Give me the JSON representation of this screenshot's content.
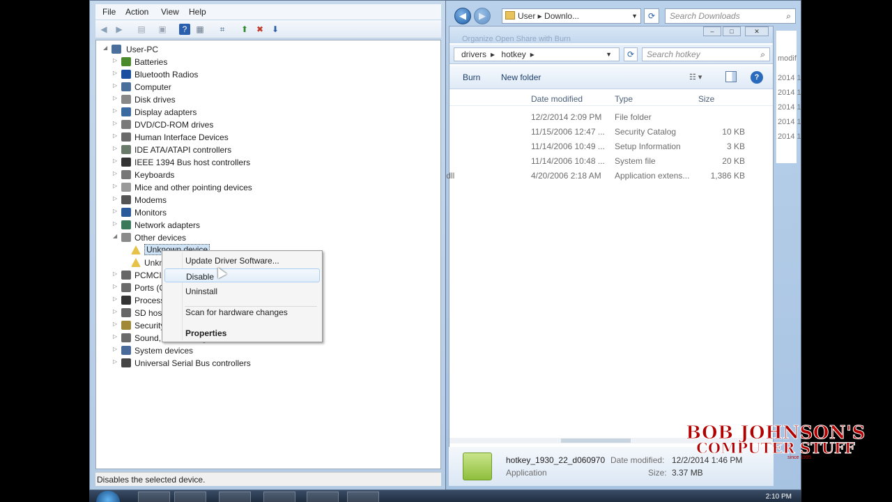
{
  "explorer_outer": {
    "address": "User ▸ Downlo...",
    "search_placeholder": "Search Downloads"
  },
  "explorer_inner": {
    "ghost_toolbar": "Organize   Open   Share with   Burn",
    "breadcrumbs": [
      "drivers",
      "hotkey"
    ],
    "search_placeholder": "Search hotkey",
    "toolbar": {
      "burn": "Burn",
      "new_folder": "New folder"
    },
    "columns": {
      "date": "Date modified",
      "type": "Type",
      "size": "Size"
    },
    "files": [
      {
        "name": "",
        "date": "12/2/2014 2:09 PM",
        "type": "File folder",
        "size": ""
      },
      {
        "name": "",
        "date": "11/15/2006 12:47 ...",
        "type": "Security Catalog",
        "size": "10 KB"
      },
      {
        "name": "",
        "date": "11/14/2006 10:49 ...",
        "type": "Setup Information",
        "size": "3 KB"
      },
      {
        "name": "",
        "date": "11/14/2006 10:48 ...",
        "type": "System file",
        "size": "20 KB"
      },
      {
        "name": ".dll",
        "date": "4/20/2006 2:18 AM",
        "type": "Application extens...",
        "size": "1,386 KB"
      }
    ],
    "details": {
      "name": "hotkey_1930_22_d060970",
      "type": "Application",
      "date_label": "Date modified:",
      "date_value": "12/2/2014 1:46 PM",
      "size_label": "Size:",
      "size_value": "3.37 MB"
    }
  },
  "right_strip": [
    "modif",
    "2014 1",
    "2014 1",
    "2014 1",
    "2014 1",
    "2014 1"
  ],
  "device_manager": {
    "menu": [
      "File",
      "Action",
      "View",
      "Help"
    ],
    "root": "User-PC",
    "categories": [
      {
        "label": "Batteries",
        "icon": "battery-icon",
        "color": "#4a8a2a"
      },
      {
        "label": "Bluetooth Radios",
        "icon": "bluetooth-icon",
        "color": "#1a4fa0"
      },
      {
        "label": "Computer",
        "icon": "computer-icon",
        "color": "#4a6f9a"
      },
      {
        "label": "Disk drives",
        "icon": "disk-drive-icon",
        "color": "#888888"
      },
      {
        "label": "Display adapters",
        "icon": "display-adapter-icon",
        "color": "#3a6aa0"
      },
      {
        "label": "DVD/CD-ROM drives",
        "icon": "dvd-drive-icon",
        "color": "#7a7a7a"
      },
      {
        "label": "Human Interface Devices",
        "icon": "hid-icon",
        "color": "#6a6a6a"
      },
      {
        "label": "IDE ATA/ATAPI controllers",
        "icon": "ide-controller-icon",
        "color": "#6a7a6a"
      },
      {
        "label": "IEEE 1394 Bus host controllers",
        "icon": "ieee1394-icon",
        "color": "#333333"
      },
      {
        "label": "Keyboards",
        "icon": "keyboard-icon",
        "color": "#777777"
      },
      {
        "label": "Mice and other pointing devices",
        "icon": "mouse-icon",
        "color": "#999999"
      },
      {
        "label": "Modems",
        "icon": "modem-icon",
        "color": "#555555"
      },
      {
        "label": "Monitors",
        "icon": "monitor-icon",
        "color": "#2a5a9a"
      },
      {
        "label": "Network adapters",
        "icon": "network-adapter-icon",
        "color": "#3a7a5a"
      },
      {
        "label": "Other devices",
        "icon": "other-devices-icon",
        "color": "#8a8a8a"
      }
    ],
    "unknown_devices": [
      "Unknown device",
      "Unknown device"
    ],
    "categories_after": [
      {
        "label": "PCMCIA adapters",
        "icon": "pcmcia-icon",
        "color": "#666666"
      },
      {
        "label": "Ports (COM & LPT)",
        "icon": "ports-icon",
        "color": "#6a6a6a"
      },
      {
        "label": "Processors",
        "icon": "processor-icon",
        "color": "#333333"
      },
      {
        "label": "SD host adapters",
        "icon": "sd-host-icon",
        "color": "#666666"
      },
      {
        "label": "Security devices",
        "icon": "security-device-icon",
        "color": "#a08a3a"
      },
      {
        "label": "Sound, video and game controllers",
        "icon": "sound-icon",
        "color": "#6a6a6a"
      },
      {
        "label": "System devices",
        "icon": "system-devices-icon",
        "color": "#4a6a9a"
      },
      {
        "label": "Universal Serial Bus controllers",
        "icon": "usb-icon",
        "color": "#444444"
      }
    ],
    "status": "Disables the selected device."
  },
  "context_menu": {
    "items": [
      "Update Driver Software...",
      "Disable",
      "Uninstall",
      "Scan for hardware changes",
      "Properties"
    ]
  },
  "watermark": {
    "line1": "BOB JOHNSON'S",
    "line2": "COMPUTER STUFF",
    "tm": "™",
    "since": "since 1995"
  },
  "taskbar": {
    "clock": "2:10 PM"
  }
}
